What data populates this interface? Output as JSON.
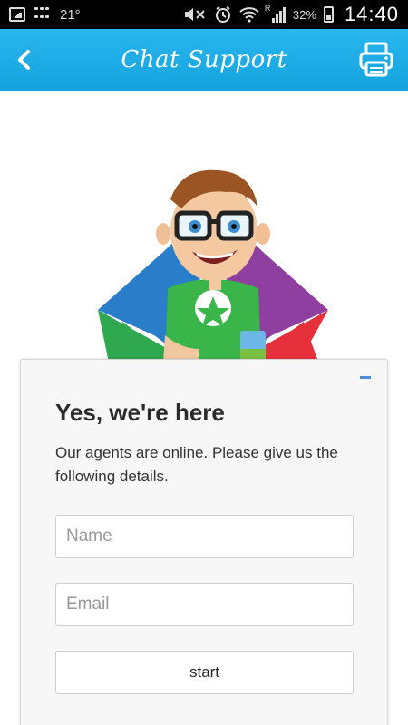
{
  "status_bar": {
    "temperature": "21°",
    "network": "R",
    "battery_pct": "32%",
    "time": "14:40",
    "icons": [
      "gallery-icon",
      "bbm-icon",
      "mute-icon",
      "alarm-icon",
      "wifi-icon",
      "signal-icon",
      "battery-icon"
    ]
  },
  "app_bar": {
    "title": "Chat Support",
    "back_icon": "chevron-left-icon",
    "print_icon": "printer-icon",
    "background": "#1aa8e4"
  },
  "illustration": {
    "subject": "cartoon-mascot-boy-with-glasses",
    "colors": [
      "#2a7ec9",
      "#8e3fa0",
      "#2fa84f",
      "#e6303c"
    ]
  },
  "card": {
    "title": "Yes, we're here",
    "description": "Our agents are online. Please give us the following details.",
    "name_placeholder": "Name",
    "email_placeholder": "Email",
    "start_label": "start",
    "minimize_icon": "minimize-icon",
    "accent": "#4a90e2"
  }
}
